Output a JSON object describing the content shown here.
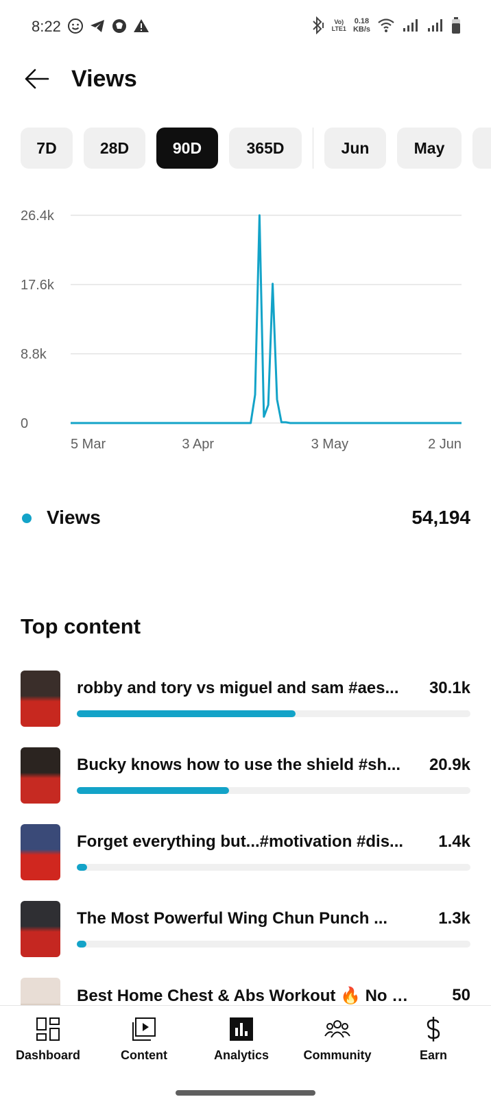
{
  "status_bar": {
    "time": "8:22",
    "left_icons": [
      "smiley-icon",
      "telegram-icon",
      "vpn-icon",
      "warning-icon"
    ],
    "lte_top": "Vo)",
    "lte_bottom": "LTE1",
    "net_speed_value": "0.18",
    "net_speed_unit": "KB/s",
    "right_icons": [
      "bluetooth-icon",
      "wifi-icon",
      "signal-icon",
      "signal-icon",
      "battery-icon"
    ]
  },
  "header": {
    "title": "Views",
    "back_icon": "arrow-left-icon"
  },
  "periods": {
    "items": [
      "7D",
      "28D",
      "90D",
      "365D",
      "Jun",
      "May"
    ],
    "selected": "90D"
  },
  "chart_data": {
    "type": "line",
    "x_tick_labels": [
      "5 Mar",
      "3 Apr",
      "3 May",
      "2 Jun"
    ],
    "y_tick_labels": [
      "0",
      "8.8k",
      "17.6k",
      "26.4k"
    ],
    "ylim": [
      0,
      26400
    ],
    "grid": true,
    "series": [
      {
        "name": "Views",
        "color": "#13a3c8",
        "x": [
          "5 Mar",
          "6 Mar",
          "7 Mar",
          "8 Mar",
          "9 Mar",
          "10 Mar",
          "11 Mar",
          "12 Mar",
          "13 Mar",
          "14 Mar",
          "15 Mar",
          "16 Mar",
          "17 Mar",
          "18 Mar",
          "19 Mar",
          "20 Mar",
          "21 Mar",
          "22 Mar",
          "23 Mar",
          "24 Mar",
          "25 Mar",
          "26 Mar",
          "27 Mar",
          "28 Mar",
          "29 Mar",
          "30 Mar",
          "31 Mar",
          "1 Apr",
          "2 Apr",
          "3 Apr",
          "4 Apr",
          "5 Apr",
          "6 Apr",
          "7 Apr",
          "8 Apr",
          "9 Apr",
          "10 Apr",
          "11 Apr",
          "12 Apr",
          "13 Apr",
          "14 Apr",
          "15 Apr",
          "16 Apr",
          "17 Apr",
          "18 Apr",
          "19 Apr",
          "20 Apr",
          "21 Apr",
          "22 Apr",
          "23 Apr",
          "24 Apr",
          "25 Apr",
          "26 Apr",
          "27 Apr",
          "28 Apr",
          "29 Apr",
          "30 Apr",
          "1 May",
          "2 May",
          "3 May",
          "4 May",
          "5 May",
          "6 May",
          "7 May",
          "8 May",
          "9 May",
          "10 May",
          "11 May",
          "12 May",
          "13 May",
          "14 May",
          "15 May",
          "16 May",
          "17 May",
          "18 May",
          "19 May",
          "20 May",
          "21 May",
          "22 May",
          "23 May",
          "24 May",
          "25 May",
          "26 May",
          "27 May",
          "28 May",
          "29 May",
          "30 May",
          "31 May",
          "1 Jun",
          "2 Jun"
        ],
        "values": [
          0,
          0,
          0,
          0,
          0,
          0,
          0,
          0,
          0,
          0,
          0,
          0,
          0,
          0,
          0,
          0,
          0,
          0,
          0,
          0,
          0,
          0,
          0,
          0,
          0,
          0,
          0,
          0,
          0,
          0,
          0,
          0,
          0,
          0,
          0,
          0,
          0,
          0,
          0,
          0,
          0,
          0,
          3600,
          26400,
          800,
          2300,
          17700,
          3000,
          100,
          100,
          0,
          0,
          0,
          0,
          0,
          0,
          0,
          0,
          0,
          0,
          0,
          0,
          0,
          0,
          0,
          0,
          0,
          0,
          0,
          0,
          0,
          0,
          0,
          0,
          0,
          0,
          0,
          0,
          0,
          0,
          0,
          0,
          0,
          0,
          0,
          0,
          0,
          0,
          0,
          0
        ]
      }
    ]
  },
  "summary": {
    "label": "Views",
    "value": "54,194",
    "color": "#13a3c8"
  },
  "top_content": {
    "title": "Top content",
    "items": [
      {
        "title": "robby and tory vs miguel and sam #aes...",
        "value": "30.1k",
        "fraction": 0.555,
        "thumb_top": "#3a2e2a",
        "thumb_bottom": "#c7281f"
      },
      {
        "title": "Bucky knows how to use the shield #sh...",
        "value": "20.9k",
        "fraction": 0.387,
        "thumb_top": "#2b2420",
        "thumb_bottom": "#c62a22"
      },
      {
        "title": "Forget everything but...#motivation #dis...",
        "value": "1.4k",
        "fraction": 0.026,
        "thumb_top": "#3a4a78",
        "thumb_bottom": "#d0271f"
      },
      {
        "title": "The Most Powerful Wing Chun Punch ...",
        "value": "1.3k",
        "fraction": 0.024,
        "thumb_top": "#2f2f33",
        "thumb_bottom": "#c52721"
      },
      {
        "title": "Best Home Chest & Abs Workout 🔥 No Eq...",
        "value": "50",
        "fraction": 0.001,
        "thumb_top": "#e8ddd5",
        "thumb_bottom": "#b8a494"
      }
    ]
  },
  "bottom_nav": {
    "items": [
      {
        "label": "Dashboard",
        "icon": "dashboard-icon"
      },
      {
        "label": "Content",
        "icon": "content-icon"
      },
      {
        "label": "Analytics",
        "icon": "analytics-icon",
        "selected": true
      },
      {
        "label": "Community",
        "icon": "community-icon"
      },
      {
        "label": "Earn",
        "icon": "earn-icon"
      }
    ]
  }
}
